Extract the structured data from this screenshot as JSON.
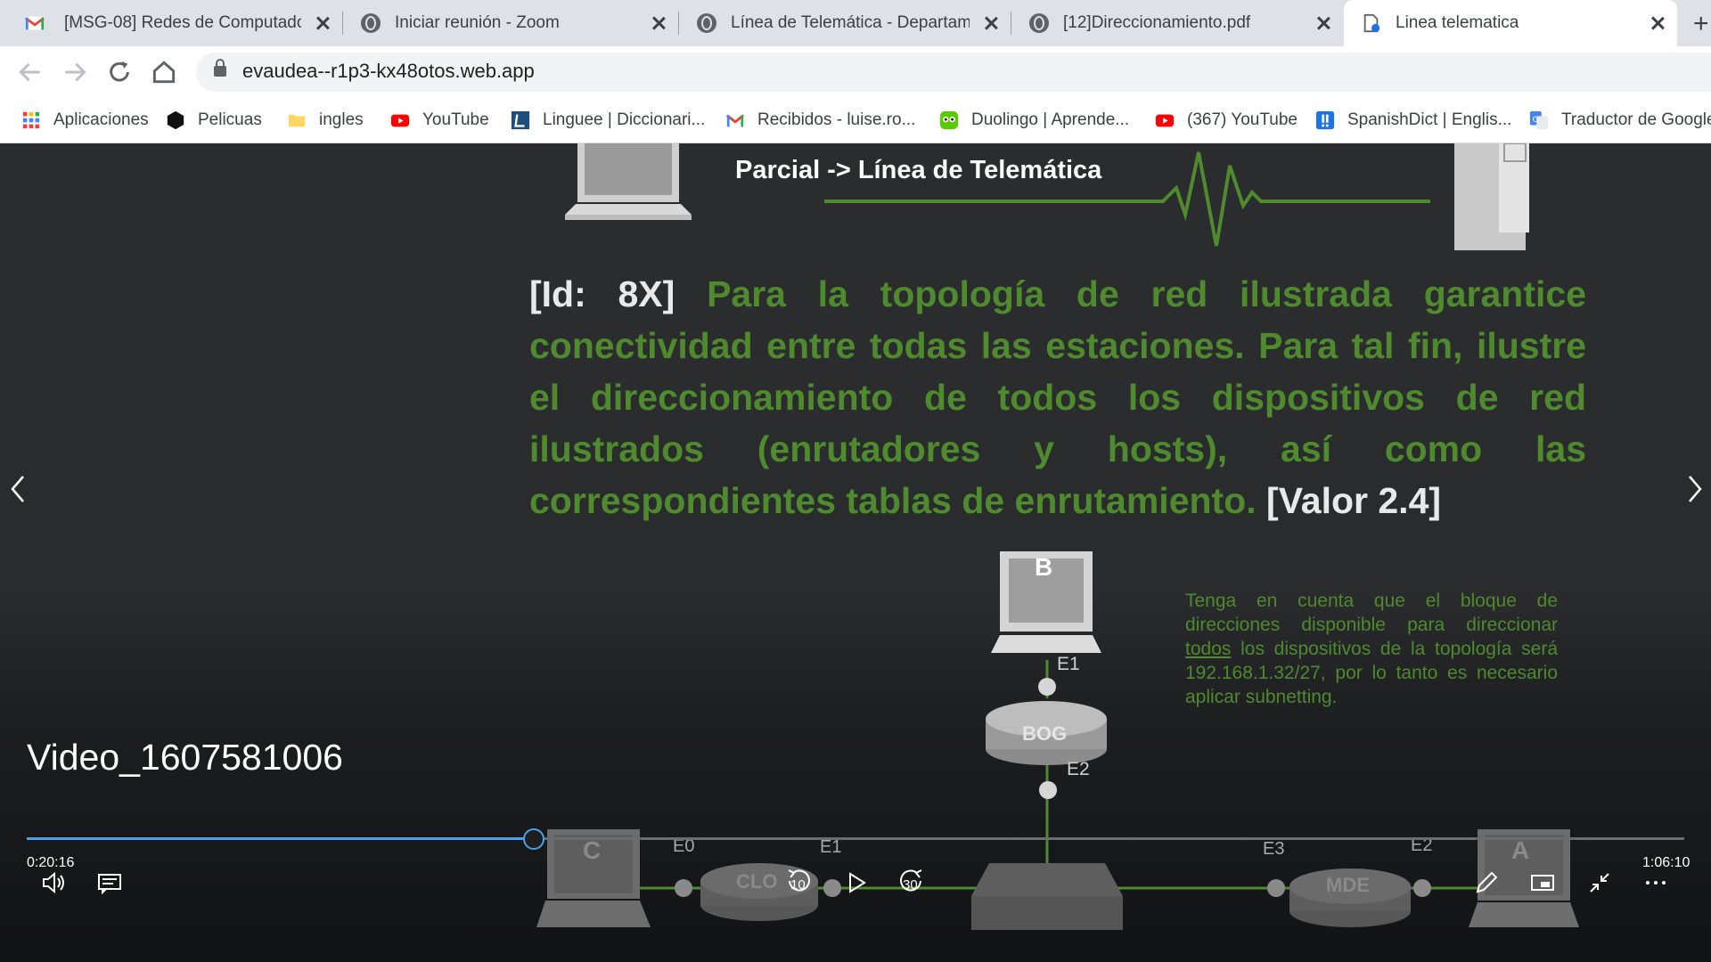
{
  "tabs": [
    {
      "title": "[MSG-08] Redes de Computador",
      "icon": "gmail-icon"
    },
    {
      "title": "Iniciar reunión - Zoom",
      "icon": "globe-icon"
    },
    {
      "title": "Línea de Telemática - Departame",
      "icon": "globe-icon"
    },
    {
      "title": "[12]Direccionamiento.pdf",
      "icon": "globe-icon"
    },
    {
      "title": "Linea telematica",
      "icon": "page-icon",
      "active": true
    }
  ],
  "address_bar": {
    "url": "evaudea--r1p3-kx48otos.web.app"
  },
  "bookmarks": [
    {
      "label": "Aplicaciones",
      "icon": "apps-grid-icon"
    },
    {
      "label": "Pelicuas",
      "icon": "hexagon-icon"
    },
    {
      "label": "ingles",
      "icon": "folder-icon"
    },
    {
      "label": "YouTube",
      "icon": "youtube-icon"
    },
    {
      "label": "Linguee | Diccionari...",
      "icon": "linguee-icon"
    },
    {
      "label": "Recibidos - luise.ro...",
      "icon": "gmail-icon"
    },
    {
      "label": "Duolingo | Aprende...",
      "icon": "duolingo-icon"
    },
    {
      "label": "(367) YouTube",
      "icon": "youtube-icon"
    },
    {
      "label": "SpanishDict | Englis...",
      "icon": "spanishdict-icon"
    },
    {
      "label": "Traductor de Google",
      "icon": "google-translate-icon"
    }
  ],
  "slide": {
    "heading": "Parcial -> Línea de Telemática",
    "question_id": "[Id: 8X]",
    "question_text": "Para la topología de red ilustrada garantice conectividad entre todas las estaciones. Para tal fin, ilustre el direccionamiento de todos los dispositivos de red ilustrados (enrutadores y hosts), así como las correspondientes tablas de enrutamiento.",
    "question_value": "[Valor 2.4]",
    "note_before": "Tenga en cuenta que el bloque de direcciones disponible para direccionar",
    "note_underlined": "todos",
    "note_after": "los dispositivos de la topología será 192.168.1.32/27, por lo tanto es necesario aplicar subnetting.",
    "diagram": {
      "host_b": "B",
      "host_c": "C",
      "host_a": "A",
      "router_bog": "BOG",
      "router_clo": "CLO",
      "router_mde": "MDE",
      "bog_e1": "E1",
      "bog_e2": "E2",
      "clo_e0": "E0",
      "clo_e1": "E1",
      "mde_e3": "E3",
      "mde_e2": "E2"
    }
  },
  "player": {
    "video_title": "Video_1607581006",
    "elapsed": "0:20:16",
    "duration": "1:06:10",
    "progress_fraction": 0.306,
    "skip_back_seconds": "10",
    "skip_forward_seconds": "30"
  }
}
